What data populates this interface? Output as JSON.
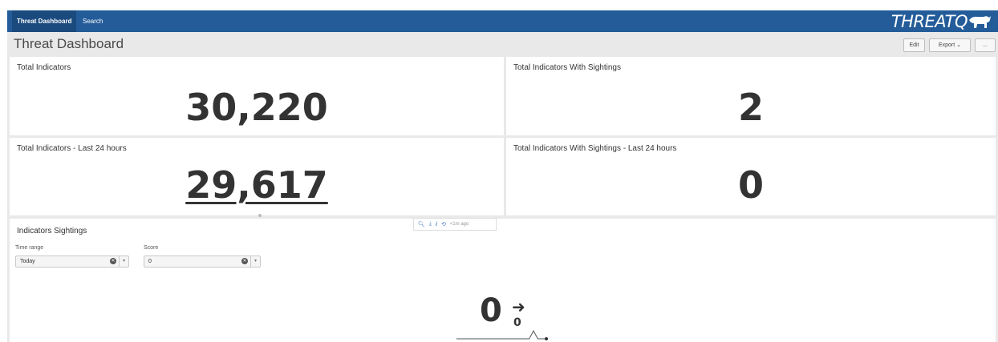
{
  "nav": {
    "tabs": [
      {
        "label": "Threat Dashboard",
        "active": true
      },
      {
        "label": "Search",
        "active": false
      }
    ],
    "logo_text": "THREATQ",
    "color": "#235c99"
  },
  "header": {
    "title": "Threat Dashboard",
    "edit_label": "Edit",
    "export_label": "Export",
    "more_label": "..."
  },
  "panels": {
    "total_indicators": {
      "title": "Total Indicators",
      "value": "30,220"
    },
    "total_sightings": {
      "title": "Total Indicators With Sightings",
      "value": "2"
    },
    "last24": {
      "title": "Total Indicators - Last 24 hours",
      "value": "29,617"
    },
    "sightings_last24": {
      "title": "Total Indicators With Sightings - Last 24 hours",
      "value": "0"
    }
  },
  "toolbar": {
    "icons": [
      "search-icon",
      "download-icon",
      "info-icon",
      "refresh-icon"
    ],
    "updated": "<1m ago"
  },
  "sightings_panel": {
    "title": "Indicators Sightings",
    "time_range": {
      "label": "Time range",
      "value": "Today"
    },
    "score": {
      "label": "Score",
      "value": "0"
    },
    "single_value": "0",
    "delta_value": "0",
    "sparkline": [
      0,
      0,
      0,
      0,
      0,
      0,
      0,
      0,
      0,
      0,
      0,
      0,
      0,
      0,
      0,
      0,
      0,
      0,
      1,
      0,
      0,
      0
    ]
  }
}
